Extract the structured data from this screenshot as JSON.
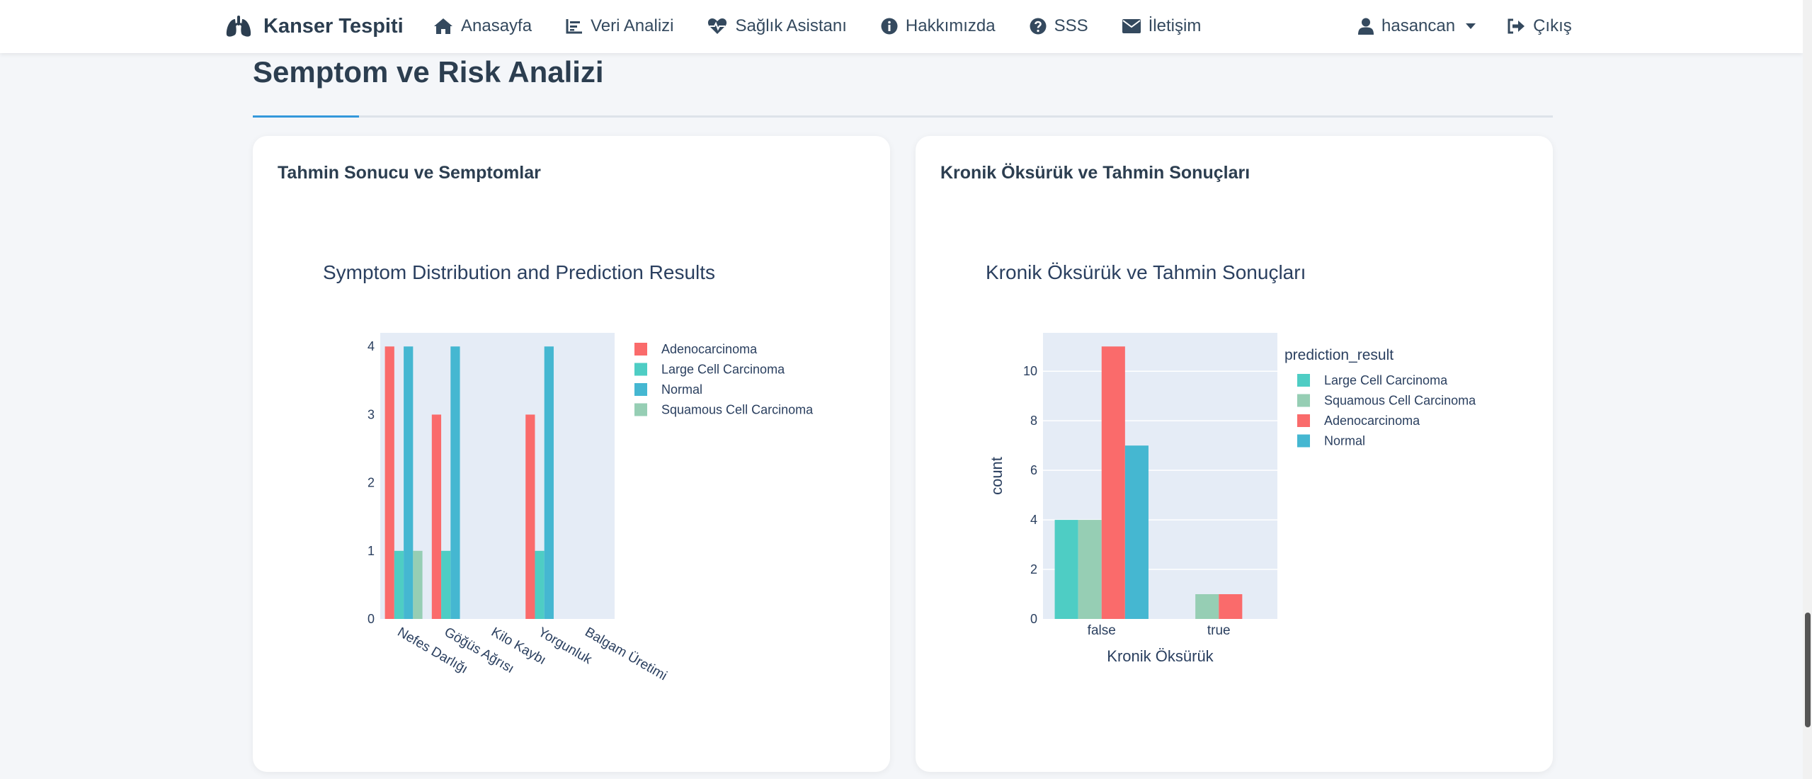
{
  "navbar": {
    "brand": "Kanser Tespiti",
    "links": [
      {
        "label": "Anasayfa",
        "icon": "home-icon"
      },
      {
        "label": "Veri Analizi",
        "icon": "chart-line-icon"
      },
      {
        "label": "Sağlık Asistanı",
        "icon": "heart-pulse-icon"
      },
      {
        "label": "Hakkımızda",
        "icon": "info-circle-icon"
      },
      {
        "label": "SSS",
        "icon": "question-circle-icon"
      },
      {
        "label": "İletişim",
        "icon": "envelope-icon"
      }
    ],
    "user": "hasancan",
    "logout": "Çıkış"
  },
  "page": {
    "section_title": "Semptom ve Risk Analizi"
  },
  "colors": {
    "Adenocarcinoma": "#fa6b6b",
    "Large Cell Carcinoma": "#4ecdc4",
    "Normal": "#45b7d1",
    "Squamous Cell Carcinoma": "#96ceb4",
    "plot_bg": "#e5ecf6",
    "accent": "#3498db"
  },
  "cards": {
    "left": {
      "header": "Tahmin Sonucu ve Semptomlar"
    },
    "right": {
      "header": "Kronik Öksürük ve Tahmin Sonuçları"
    }
  },
  "chart_data": [
    {
      "type": "bar",
      "title": "Symptom Distribution and Prediction Results",
      "xlabel": "",
      "ylabel": "",
      "categories": [
        "Nefes Darlığı",
        "Göğüs Ağrısı",
        "Kilo Kaybı",
        "Yorgunluk",
        "Balgam Üretimi"
      ],
      "ylim": [
        0,
        4.2
      ],
      "yticks": [
        0,
        1,
        2,
        3,
        4
      ],
      "legend_position": "right",
      "grid": false,
      "series": [
        {
          "name": "Adenocarcinoma",
          "values": [
            4,
            3,
            0,
            3,
            0
          ]
        },
        {
          "name": "Large Cell Carcinoma",
          "values": [
            1,
            1,
            0,
            1,
            0
          ]
        },
        {
          "name": "Normal",
          "values": [
            4,
            4,
            0,
            4,
            0
          ]
        },
        {
          "name": "Squamous Cell Carcinoma",
          "values": [
            1,
            0,
            0,
            0,
            0
          ]
        }
      ]
    },
    {
      "type": "bar",
      "title": "Kronik Öksürük ve Tahmin Sonuçları",
      "xlabel": "Kronik Öksürük",
      "ylabel": "count",
      "legend_title": "prediction_result",
      "categories": [
        "false",
        "true"
      ],
      "ylim": [
        0,
        11.55
      ],
      "yticks": [
        0,
        2,
        4,
        6,
        8,
        10
      ],
      "legend_position": "right",
      "grid": true,
      "series": [
        {
          "name": "Large Cell Carcinoma",
          "values": [
            4,
            0
          ]
        },
        {
          "name": "Squamous Cell Carcinoma",
          "values": [
            4,
            1
          ]
        },
        {
          "name": "Adenocarcinoma",
          "values": [
            11,
            1
          ]
        },
        {
          "name": "Normal",
          "values": [
            7,
            0
          ]
        }
      ]
    }
  ]
}
